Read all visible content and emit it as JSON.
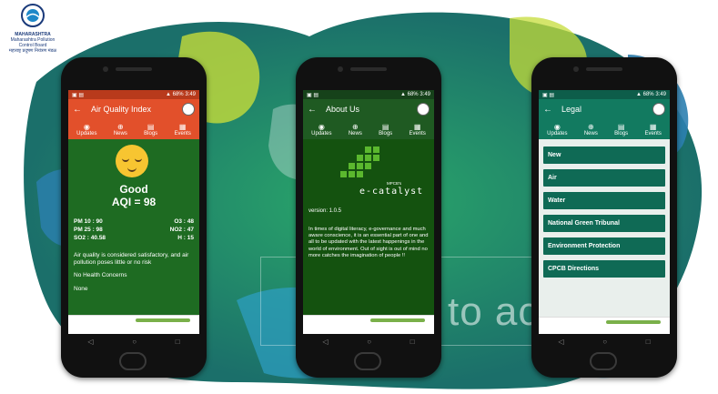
{
  "colors": {
    "orange": "#e2502b",
    "dark_green": "#1f5a22",
    "teal": "#127a60"
  },
  "logo": {
    "name": "MAHARASHTRA",
    "org": "Maharashtra Pollution Control Board",
    "org_marathi": "महाराष्ट्र प्रदूषण नियंत्रण मंडळ"
  },
  "background_text": "to ac",
  "status": {
    "battery": "68%",
    "time": "3:49"
  },
  "tabs": [
    {
      "label": "Updates",
      "icon": "globe-icon"
    },
    {
      "label": "News",
      "icon": "world-icon"
    },
    {
      "label": "Blogs",
      "icon": "blog-icon"
    },
    {
      "label": "Events",
      "icon": "calendar-icon"
    }
  ],
  "phone1": {
    "title": "Air Quality Index",
    "aqi_status": "Good",
    "aqi_value": "AQI = 98",
    "pollutants_left": [
      "PM 10 : 90",
      "PM 25 : 98",
      "SO2 : 40.58"
    ],
    "pollutants_right": [
      "O3 : 48",
      "NO2 : 47",
      "H : 15"
    ],
    "description": "Air quality is considered satisfactory, and air pollution poses little or no risk",
    "health": "No Health Concerns",
    "none": "None"
  },
  "phone2": {
    "title": "About Us",
    "logo_text": "e-catalyst",
    "logo_small": "MPCB's",
    "version": "version: 1.0.5",
    "paragraph": "In times of digital literacy, e-governance and much aware conscience, it is an essential part of one and all to be updated with the latest happenings in the world of environment. Out of sight is out of mind no more catches the imagination of people !!"
  },
  "phone3": {
    "title": "Legal",
    "items": [
      "New",
      "Air",
      "Water",
      "National Green Tribunal",
      "Environment Protection",
      "CPCB Directions"
    ]
  }
}
